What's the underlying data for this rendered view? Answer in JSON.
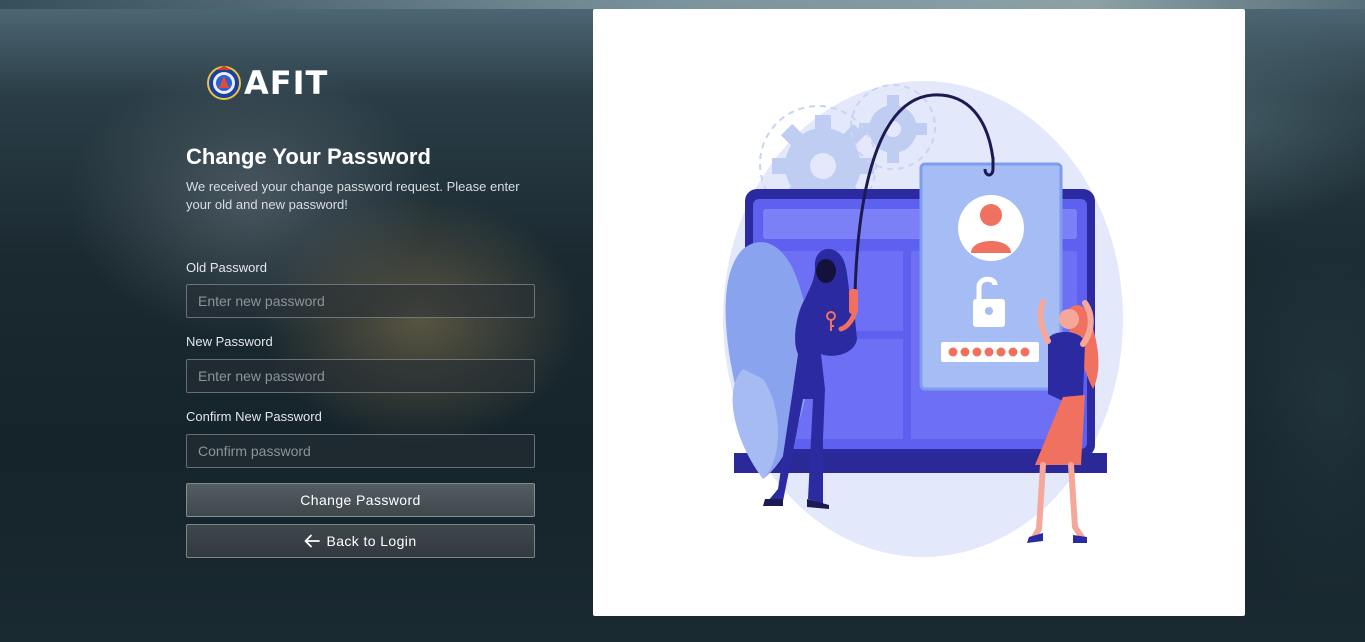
{
  "brand": {
    "logo_text": "AFIT"
  },
  "form": {
    "title": "Change Your Password",
    "subtitle": "We received your change password request. Please enter your old and new password!",
    "old_password": {
      "label": "Old Password",
      "placeholder": "Enter new password",
      "value": ""
    },
    "new_password": {
      "label": "New Password",
      "placeholder": "Enter new password",
      "value": ""
    },
    "confirm_password": {
      "label": "Confirm New Password",
      "placeholder": "Confirm password",
      "value": ""
    },
    "submit_label": "Change Password",
    "back_label": "Back to Login"
  },
  "icons": {
    "back": "arrow-left-icon",
    "logo": "afit-emblem-icon"
  },
  "colors": {
    "illustration_blue": "#5b5ef0",
    "illustration_dark": "#26218f",
    "illustration_coral": "#f0715f",
    "card_background": "#ffffff"
  }
}
